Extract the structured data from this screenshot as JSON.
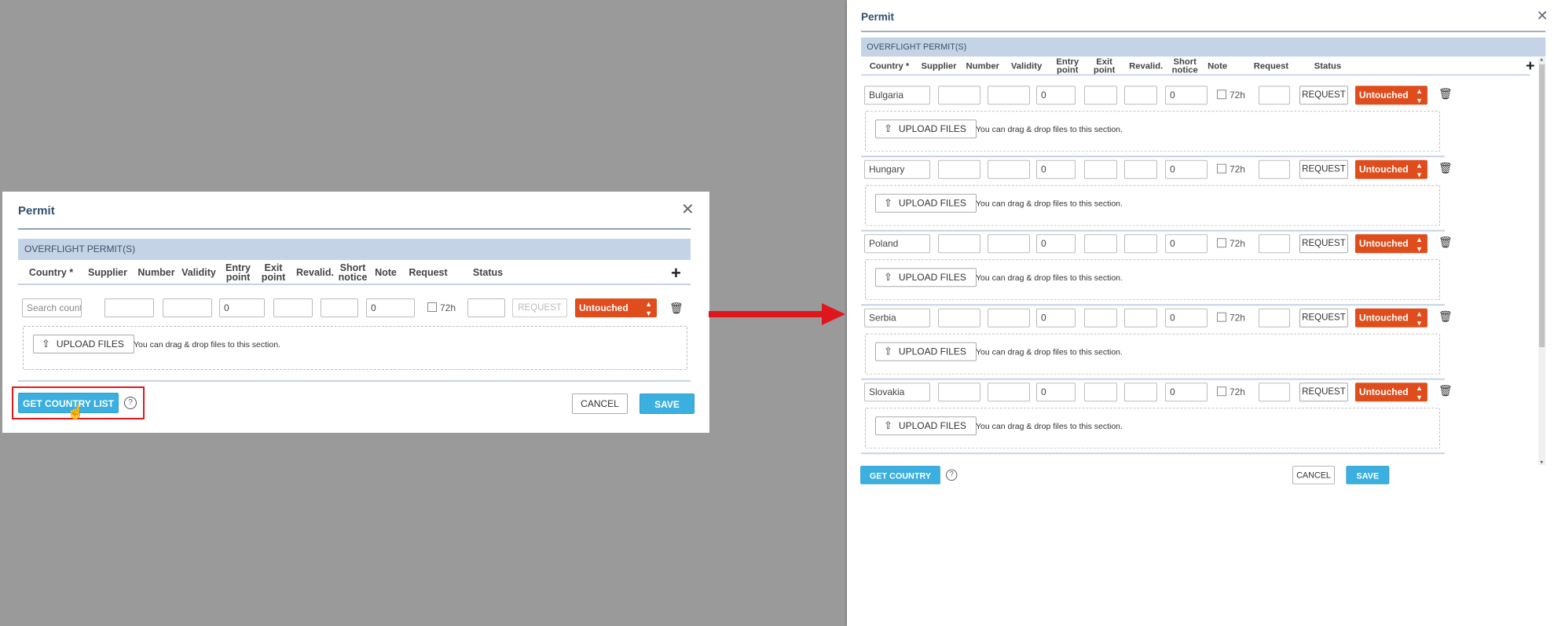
{
  "dialog": {
    "title": "Permit",
    "close_glyph": "✕",
    "section_header": "OVERFLIGHT PERMIT(S)",
    "columns": {
      "country": "Country *",
      "supplier": "Supplier",
      "number": "Number",
      "validity": "Validity",
      "entry_l1": "Entry",
      "entry_l2": "point",
      "exit_l1": "Exit",
      "exit_l2": "point",
      "revalid": "Revalid.",
      "short_l1": "Short",
      "short_l2": "notice",
      "note": "Note",
      "request": "Request",
      "status": "Status"
    },
    "add_glyph": "+",
    "short_notice_label": "72h",
    "request_button": "REQUEST",
    "status_value": "Untouched",
    "status_color": "#e04d1c",
    "upload_button": "UPLOAD FILES",
    "drop_note": "You can drag & drop files to this section.",
    "footer": {
      "get_country_list": "GET COUNTRY LIST",
      "help_glyph": "?",
      "cancel": "CANCEL",
      "save": "SAVE"
    }
  },
  "left_row": {
    "country_placeholder": "Search country",
    "validity": "0",
    "revalid": "0"
  },
  "right_rows": [
    {
      "country": "Bulgaria",
      "validity": "0",
      "revalid": "0"
    },
    {
      "country": "Hungary",
      "validity": "0",
      "revalid": "0"
    },
    {
      "country": "Poland",
      "validity": "0",
      "revalid": "0"
    },
    {
      "country": "Serbia",
      "validity": "0",
      "revalid": "0"
    },
    {
      "country": "Slovakia",
      "validity": "0",
      "revalid": "0"
    }
  ],
  "icons": {
    "close": "close-icon",
    "add": "plus-icon",
    "trash": "trash-icon",
    "upload": "upload-icon",
    "help": "help-circle-icon",
    "arrow": "right-arrow-icon",
    "cursor": "hand-pointer-icon"
  },
  "accent_colors": {
    "header_band": "#c5d3e6",
    "primary_button": "#3aafe0",
    "status": "#e04d1c",
    "annotation": "#e0161d"
  }
}
